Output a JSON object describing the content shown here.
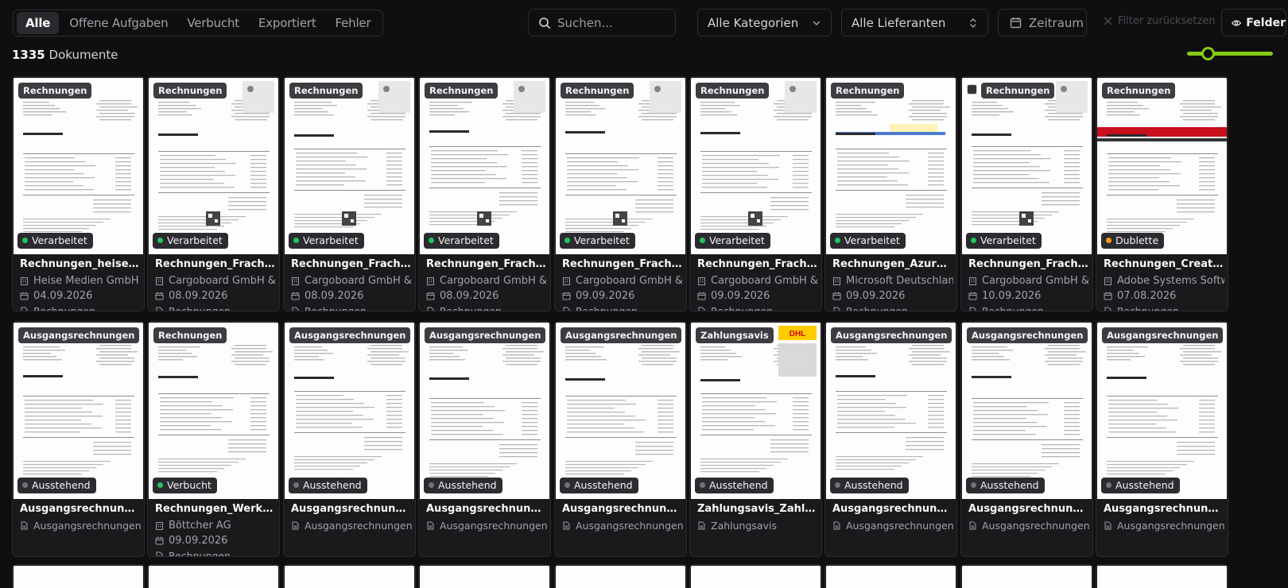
{
  "tabs": [
    {
      "label": "Alle",
      "active": true
    },
    {
      "label": "Offene Aufgaben",
      "active": false
    },
    {
      "label": "Verbucht",
      "active": false
    },
    {
      "label": "Exportiert",
      "active": false
    },
    {
      "label": "Fehler",
      "active": false
    }
  ],
  "search": {
    "placeholder": "Suchen...",
    "icon": "search-icon"
  },
  "filters": {
    "category": "Alle Kategorien",
    "supplier": "Alle Lieferanten",
    "date": "Zeitraum",
    "reset": "Filter zurücksetzen",
    "fields": "Felder"
  },
  "summary": {
    "count": "1335",
    "label": "Dokumente"
  },
  "zoom": {
    "level": 0.2
  },
  "colors": {
    "accent": "#84cc16",
    "processed": "#22c55e",
    "duplicate": "#f59e0b",
    "pending": "#71717a",
    "booked": "#22c55e"
  },
  "documents": [
    {
      "category": "Rechnungen",
      "status": "Verarbeitet",
      "status_color": "#22c55e",
      "name": "Rechnungen_heise+ All-In",
      "supplier": "Heise Medien GmbH &",
      "date": "04.09.2026",
      "folder": "Rechnungen"
    },
    {
      "category": "Rechnungen",
      "status": "Verarbeitet",
      "status_color": "#22c55e",
      "name": "Rechnungen_Frachttransport",
      "supplier": "Cargoboard GmbH & C",
      "date": "08.09.2026",
      "folder": "Rechnungen"
    },
    {
      "category": "Rechnungen",
      "status": "Verarbeitet",
      "status_color": "#22c55e",
      "name": "Rechnungen_Frachttransport",
      "supplier": "Cargoboard GmbH & C",
      "date": "08.09.2026",
      "folder": "Rechnungen"
    },
    {
      "category": "Rechnungen",
      "status": "Verarbeitet",
      "status_color": "#22c55e",
      "name": "Rechnungen_Frachtkosten",
      "supplier": "Cargoboard GmbH & C",
      "date": "08.09.2026",
      "folder": "Rechnungen"
    },
    {
      "category": "Rechnungen",
      "status": "Verarbeitet",
      "status_color": "#22c55e",
      "name": "Rechnungen_Frachtkosten",
      "supplier": "Cargoboard GmbH & C",
      "date": "09.09.2026",
      "folder": "Rechnungen"
    },
    {
      "category": "Rechnungen",
      "status": "Verarbeitet",
      "status_color": "#22c55e",
      "name": "Rechnungen_Frachtkosten",
      "supplier": "Cargoboard GmbH & C",
      "date": "09.09.2026",
      "folder": "Rechnungen"
    },
    {
      "category": "Rechnungen",
      "status": "Verarbeitet",
      "status_color": "#22c55e",
      "name": "Rechnungen_Azure Nutzung",
      "supplier": "Microsoft Deutschland",
      "date": "09.09.2026",
      "folder": "Rechnungen"
    },
    {
      "category": "Rechnungen",
      "status": "Verarbeitet",
      "status_color": "#22c55e",
      "name": "Rechnungen_Frachtkosten",
      "supplier": "Cargoboard GmbH & C",
      "date": "10.09.2026",
      "folder": "Rechnungen",
      "checkbox": true
    },
    {
      "category": "Rechnungen",
      "status": "Dublette",
      "status_color": "#f59e0b",
      "name": "Rechnungen_Creative Cloud",
      "supplier": "Adobe Systems Software",
      "date": "07.08.2026",
      "folder": "Rechnungen"
    },
    {
      "category": "Ausgangsrechnungen",
      "status": "Ausstehend",
      "status_color": "#71717a",
      "name": "Ausgangsrechnungen_Auftrag",
      "folder": "Ausgangsrechnungen"
    },
    {
      "category": "Rechnungen",
      "status": "Verbucht",
      "status_color": "#22c55e",
      "name": "Rechnungen_Werkzeug Bestellung",
      "supplier": "Böttcher AG",
      "date": "09.09.2026",
      "folder": "Rechnungen"
    },
    {
      "category": "Ausgangsrechnungen",
      "status": "Ausstehend",
      "status_color": "#71717a",
      "name": "Ausgangsrechnungen_Vertrieb",
      "folder": "Ausgangsrechnungen"
    },
    {
      "category": "Ausgangsrechnungen",
      "status": "Ausstehend",
      "status_color": "#71717a",
      "name": "Ausgangsrechnungen_Consulting",
      "folder": "Ausgangsrechnungen"
    },
    {
      "category": "Ausgangsrechnungen",
      "status": "Ausstehend",
      "status_color": "#71717a",
      "name": "Ausgangsrechnungen_Airline",
      "folder": "Ausgangsrechnungen"
    },
    {
      "category": "Zahlungsavis",
      "status": "Ausstehend",
      "status_color": "#71717a",
      "name": "Zahlungsavis_Zahlungsauftrag",
      "folder": "Zahlungsavis"
    },
    {
      "category": "Ausgangsrechnungen",
      "status": "Ausstehend",
      "status_color": "#71717a",
      "name": "Ausgangsrechnungen_Allgemein",
      "folder": "Ausgangsrechnungen"
    },
    {
      "category": "Ausgangsrechnungen",
      "status": "Ausstehend",
      "status_color": "#71717a",
      "name": "Ausgangsrechnungen_Allgemein",
      "folder": "Ausgangsrechnungen"
    },
    {
      "category": "Ausgangsrechnungen",
      "status": "Ausstehend",
      "status_color": "#71717a",
      "name": "Ausgangsrechnungen_Gesamt",
      "folder": "Ausgangsrechnungen"
    }
  ]
}
